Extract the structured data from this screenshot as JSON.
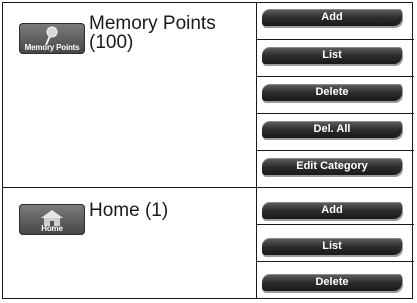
{
  "categories": [
    {
      "icon_name": "memory-points-pin-icon",
      "icon_caption": "Memory Points",
      "label": "Memory Points (100)",
      "buttons": [
        "Add",
        "List",
        "Delete",
        "Del. All",
        "Edit Category"
      ]
    },
    {
      "icon_name": "home-house-icon",
      "icon_caption": "Home",
      "label": "Home (1)",
      "buttons": [
        "Add",
        "List",
        "Delete"
      ]
    }
  ]
}
